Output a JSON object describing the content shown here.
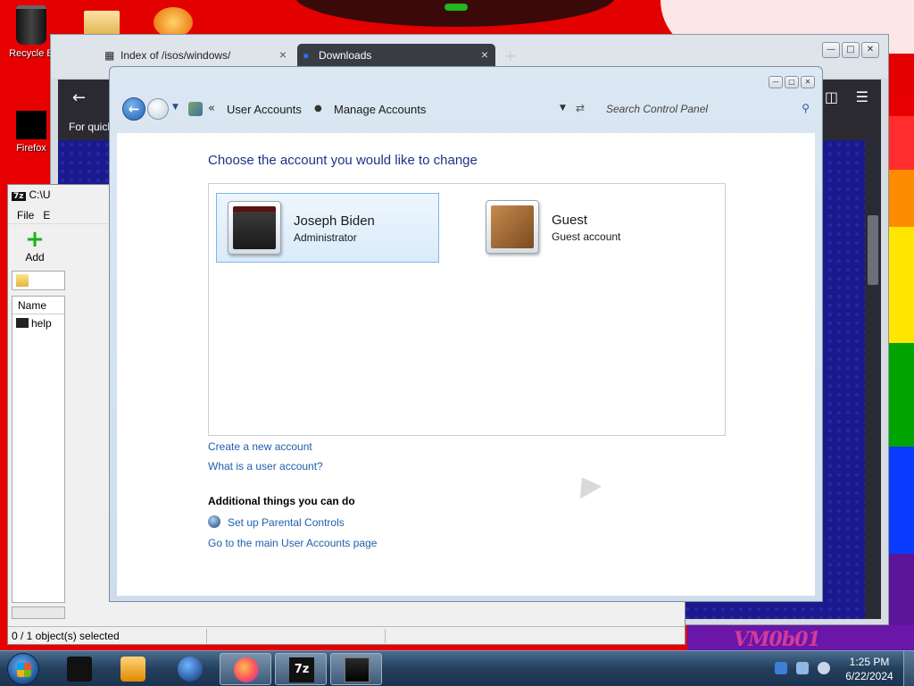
{
  "desktop": {
    "icons": [
      {
        "label": "Recycle B"
      },
      {
        "label": "Firefox"
      }
    ],
    "watermark": "VM0b01"
  },
  "browser": {
    "tabs": [
      {
        "label": "Index of /isos/windows/"
      },
      {
        "label": "Downloads"
      }
    ],
    "quick_text": "For quick"
  },
  "sevenzip": {
    "title": "C:\\U",
    "menu": [
      "File",
      "E"
    ],
    "add_label": "Add",
    "list_header": "Name",
    "rows": [
      "help"
    ],
    "status": "0 / 1 object(s) selected"
  },
  "control_panel": {
    "breadcrumb": [
      "User Accounts",
      "Manage Accounts"
    ],
    "search_placeholder": "Search Control Panel",
    "heading": "Choose the account you would like to change",
    "accounts": [
      {
        "name": "Joseph Biden",
        "type": "Administrator"
      },
      {
        "name": "Guest",
        "type": "Guest account"
      }
    ],
    "links": {
      "create": "Create a new account",
      "what_is": "What is a user account?"
    },
    "additional_heading": "Additional things you can do",
    "additional_links": {
      "parental": "Set up Parental Controls",
      "main_page": "Go to the main User Accounts page"
    }
  },
  "taskbar": {
    "clock_time": "1:25 PM",
    "clock_date": "6/22/2024"
  },
  "colors": {
    "link": "#1e5fad",
    "heading": "#1e3287",
    "selection": "#d9ebfa"
  }
}
